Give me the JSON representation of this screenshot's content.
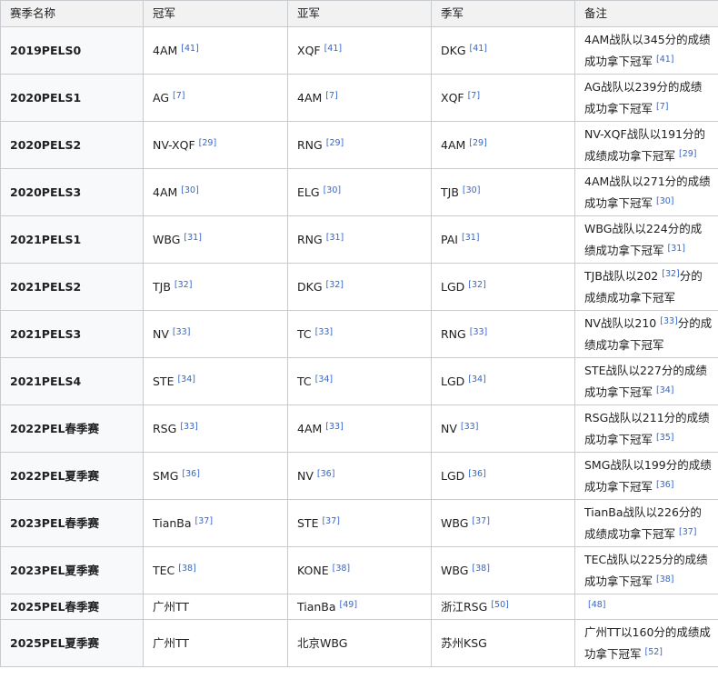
{
  "headers": [
    "赛季名称",
    "冠军",
    "亚军",
    "季军",
    "备注"
  ],
  "rows": [
    {
      "season": "2019PELS0",
      "champion": "4AM",
      "c_ref": "[41]",
      "runner": "XQF",
      "r_ref": "[41]",
      "third": "DKG",
      "t_ref": "[41]",
      "note": "4AM战队以345分的成绩成功拿下冠军",
      "n_ref": "[41]"
    },
    {
      "season": "2020PELS1",
      "champion": "AG",
      "c_ref": "[7]",
      "runner": "4AM",
      "r_ref": "[7]",
      "third": "XQF",
      "t_ref": "[7]",
      "note": "AG战队以239分的成绩成功拿下冠军",
      "n_ref": "[7]"
    },
    {
      "season": "2020PELS2",
      "champion": "NV-XQF",
      "c_ref": "[29]",
      "runner": "RNG",
      "r_ref": "[29]",
      "third": "4AM",
      "t_ref": "[29]",
      "note": "NV-XQF战队以191分的成绩成功拿下冠军",
      "n_ref": "[29]"
    },
    {
      "season": "2020PELS3",
      "champion": "4AM",
      "c_ref": "[30]",
      "runner": "ELG",
      "r_ref": "[30]",
      "third": "TJB",
      "t_ref": "[30]",
      "note": "4AM战队以271分的成绩成功拿下冠军",
      "n_ref": "[30]"
    },
    {
      "season": "2021PELS1",
      "champion": "WBG",
      "c_ref": "[31]",
      "runner": "RNG",
      "r_ref": "[31]",
      "third": "PAI",
      "t_ref": "[31]",
      "note": "WBG战队以224分的成绩成功拿下冠军",
      "n_ref": "[31]"
    },
    {
      "season": "2021PELS2",
      "champion": "TJB",
      "c_ref": "[32]",
      "runner": "DKG",
      "r_ref": "[32]",
      "third": "LGD",
      "t_ref": "[32]",
      "note_a": "TJB战队以202",
      "n_ref": "[32]",
      "note_b": "分的成绩成功拿下冠军"
    },
    {
      "season": "2021PELS3",
      "champion": "NV",
      "c_ref": "[33]",
      "runner": "TC",
      "r_ref": "[33]",
      "third": "RNG",
      "t_ref": "[33]",
      "note_a": "NV战队以210",
      "n_ref": "[33]",
      "note_b": "分的成绩成功拿下冠军"
    },
    {
      "season": "2021PELS4",
      "champion": "STE",
      "c_ref": "[34]",
      "runner": "TC",
      "r_ref": "[34]",
      "third": "LGD",
      "t_ref": "[34]",
      "note": "STE战队以227分的成绩成功拿下冠军",
      "n_ref": "[34]"
    },
    {
      "season": "2022PEL春季赛",
      "champion": "RSG",
      "c_ref": "[33]",
      "runner": "4AM",
      "r_ref": "[33]",
      "third": "NV",
      "t_ref": "[33]",
      "note": "RSG战队以211分的成绩成功拿下冠军",
      "n_ref": "[35]"
    },
    {
      "season": "2022PEL夏季赛",
      "champion": "SMG",
      "c_ref": "[36]",
      "runner": "NV",
      "r_ref": "[36]",
      "third": "LGD",
      "t_ref": "[36]",
      "note": "SMG战队以199分的成绩成功拿下冠军",
      "n_ref": "[36]"
    },
    {
      "season": "2023PEL春季赛",
      "champion": "TianBa",
      "c_ref": "[37]",
      "runner": "STE",
      "r_ref": "[37]",
      "third": "WBG",
      "t_ref": "[37]",
      "note": "TianBa战队以226分的成绩成功拿下冠军",
      "n_ref": "[37]"
    },
    {
      "season": "2023PEL夏季赛",
      "champion": "TEC",
      "c_ref": "[38]",
      "runner": "KONE",
      "r_ref": "[38]",
      "third": "WBG",
      "t_ref": "[38]",
      "note": "TEC战队以225分的成绩成功拿下冠军",
      "n_ref": "[38]"
    },
    {
      "season": "2025PEL春季赛",
      "champion": "广州TT",
      "c_ref": "",
      "runner": "TianBa",
      "r_ref": "[49]",
      "third": "浙江RSG",
      "t_ref": "[50]",
      "note": "",
      "n_ref": "[48]"
    },
    {
      "season": "2025PEL夏季赛",
      "champion": "广州TT",
      "c_ref": "",
      "runner": "北京WBG",
      "r_ref": "",
      "third": "苏州KSG",
      "t_ref": "",
      "note": "广州TT以160分的成绩成功拿下冠军",
      "n_ref": "[52]"
    }
  ]
}
